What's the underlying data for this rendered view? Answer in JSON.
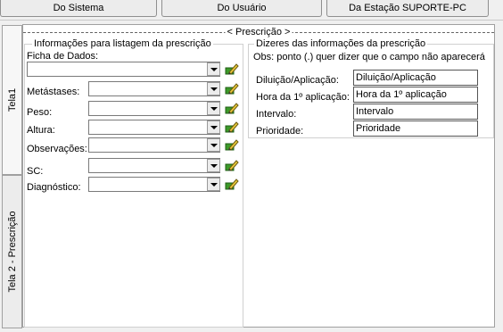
{
  "top_tabs": [
    "Do Sistema",
    "Do Usuário",
    "Da Estação SUPORTE-PC"
  ],
  "side_tabs": [
    "Tela1",
    "Tela 2 - Prescrição"
  ],
  "prescricao_title": "< Prescrição >",
  "left_group": {
    "title": "Informações para listagem da prescrição",
    "ficha_label": "Ficha de Dados:",
    "rows": [
      "Metástases:",
      "Peso:",
      "Altura:",
      "Observações:",
      "SC:",
      "Diagnóstico:"
    ]
  },
  "right_group": {
    "title": "Dizeres das informações da prescrição",
    "note": "Obs: ponto (.) quer dizer que o campo não aparecerá",
    "fields": [
      {
        "label": "Diluição/Aplicação:",
        "value": "Diluição/Aplicação"
      },
      {
        "label": "Hora da 1º aplicação:",
        "value": "Hora da 1º aplicação"
      },
      {
        "label": "Intervalo:",
        "value": "Intervalo"
      },
      {
        "label": "Prioridade:",
        "value": "Prioridade"
      }
    ]
  },
  "icons": {
    "combo_arrow": "chevron-down-icon",
    "edit": "edit-pencil-icon"
  },
  "colors": {
    "panel_bg": "#ffffff",
    "window_bg": "#f0f0f0",
    "icon_green": "#3c9a2a",
    "icon_yellow": "#e8c83a"
  }
}
